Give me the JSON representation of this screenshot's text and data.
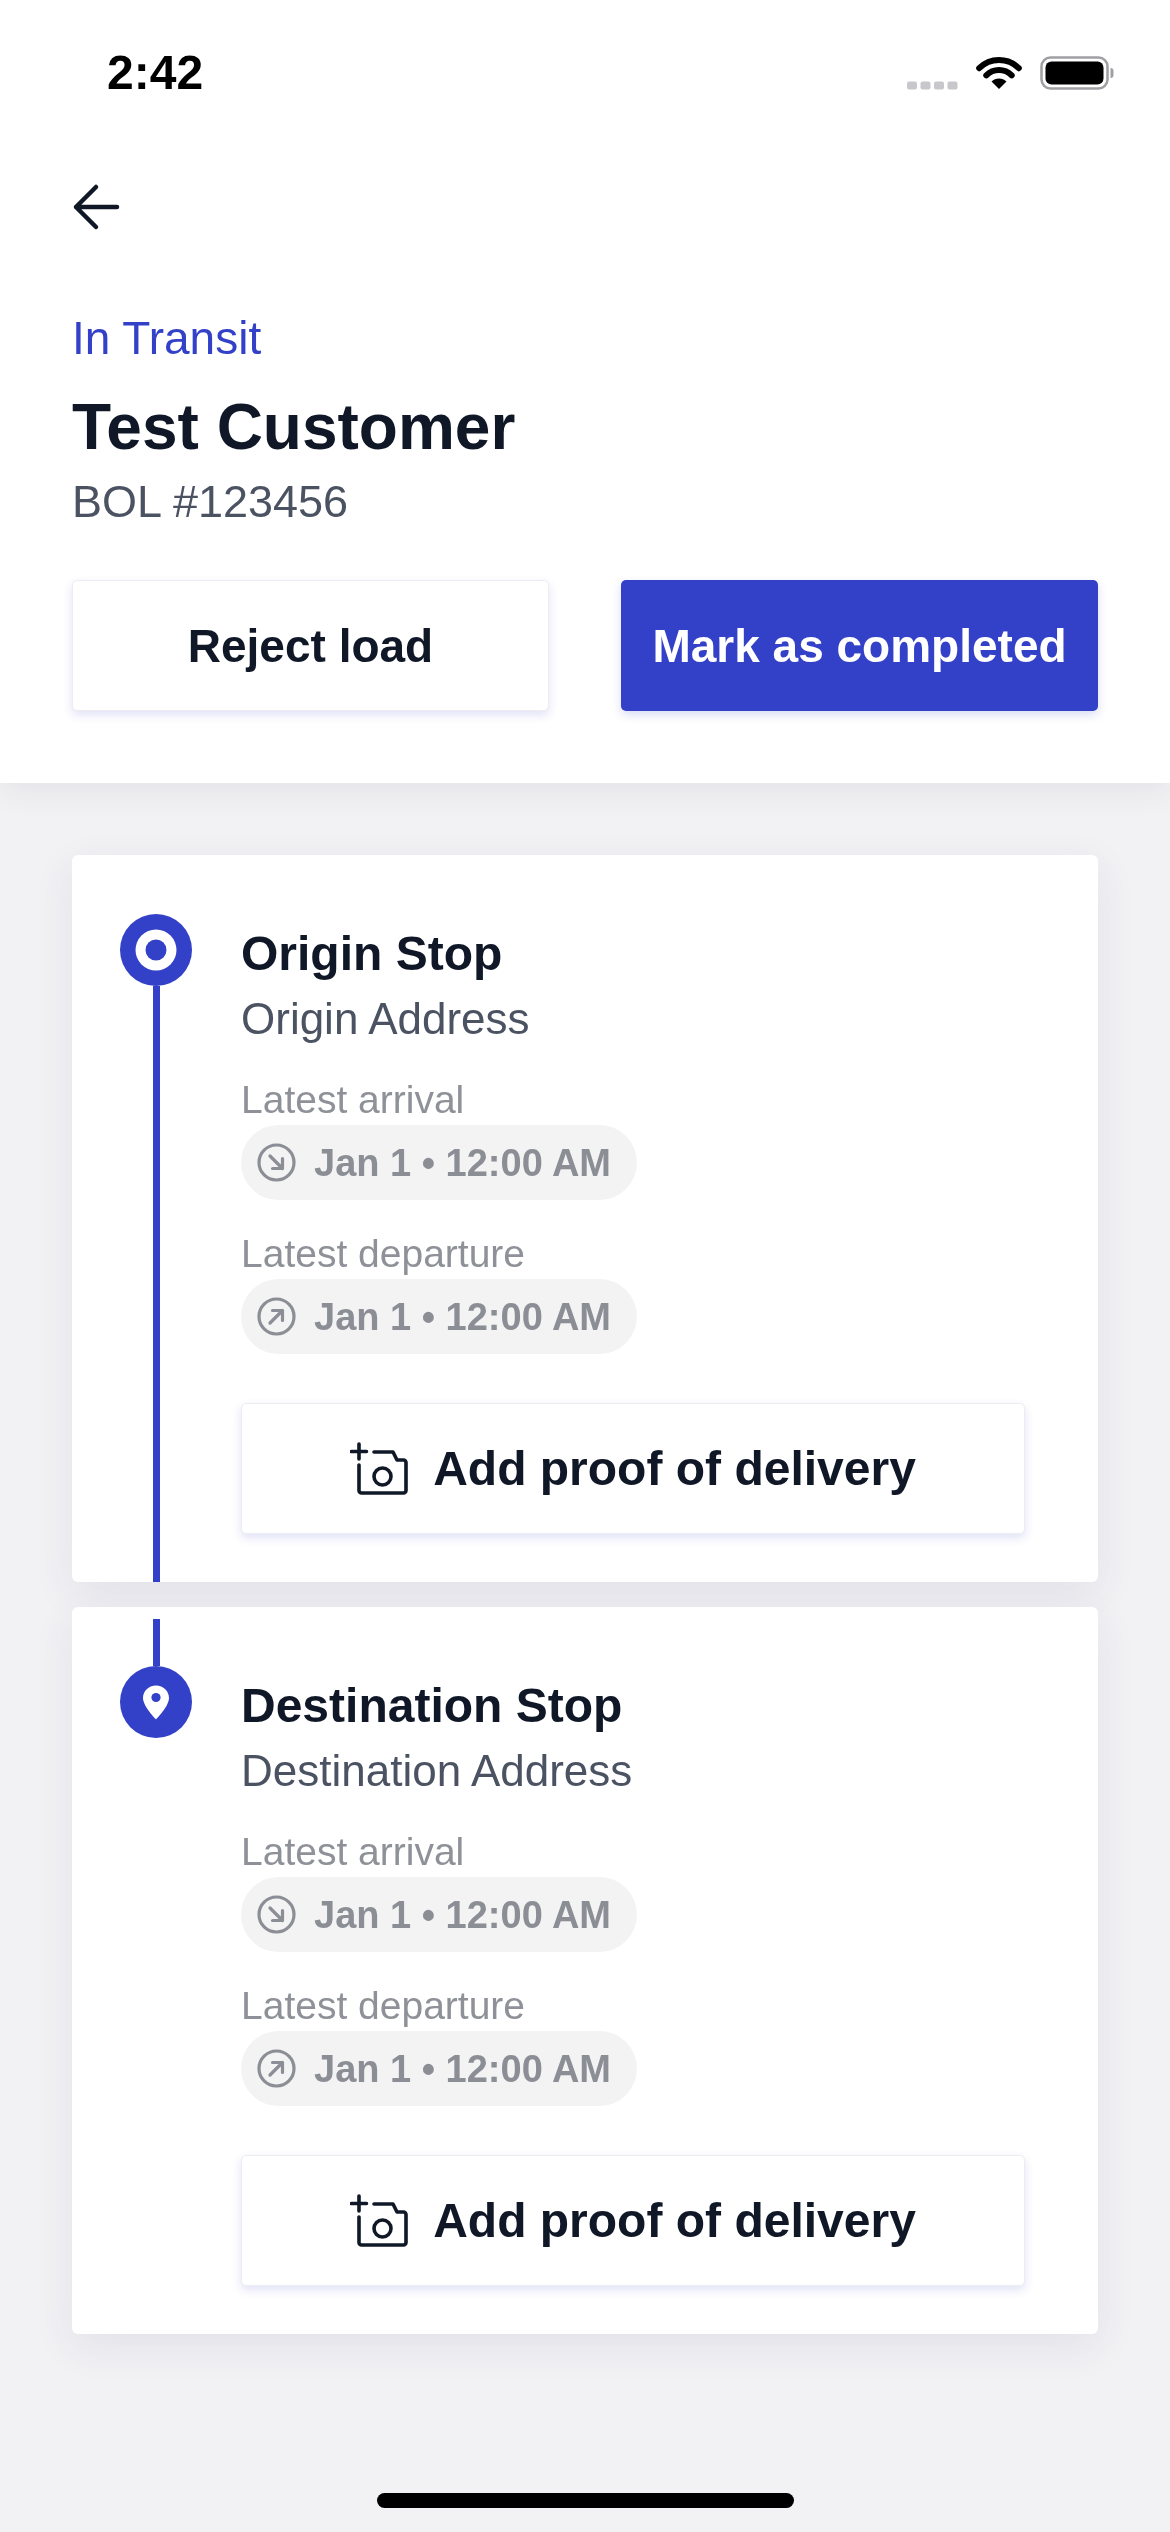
{
  "status_bar": {
    "time": "2:42"
  },
  "header": {
    "status": "In Transit",
    "customer": "Test Customer",
    "reference": "BOL #123456",
    "buttons": [
      {
        "kind": "secondary",
        "label": "Reject load"
      },
      {
        "kind": "primary",
        "label": "Mark as completed"
      }
    ]
  },
  "stops": [
    {
      "kind": "origin",
      "title": "Origin Stop",
      "address": "Origin Address",
      "times": [
        {
          "kind": "arrival",
          "label": "Latest arrival",
          "value": "Jan 1 • 12:00 AM"
        },
        {
          "kind": "departure",
          "label": "Latest departure",
          "value": "Jan 1 • 12:00 AM"
        }
      ],
      "action": "Add proof of delivery"
    },
    {
      "kind": "destination",
      "title": "Destination Stop",
      "address": "Destination Address",
      "times": [
        {
          "kind": "arrival",
          "label": "Latest arrival",
          "value": "Jan 1 • 12:00 AM"
        },
        {
          "kind": "departure",
          "label": "Latest departure",
          "value": "Jan 1 • 12:00 AM"
        }
      ],
      "action": "Add proof of delivery"
    }
  ]
}
